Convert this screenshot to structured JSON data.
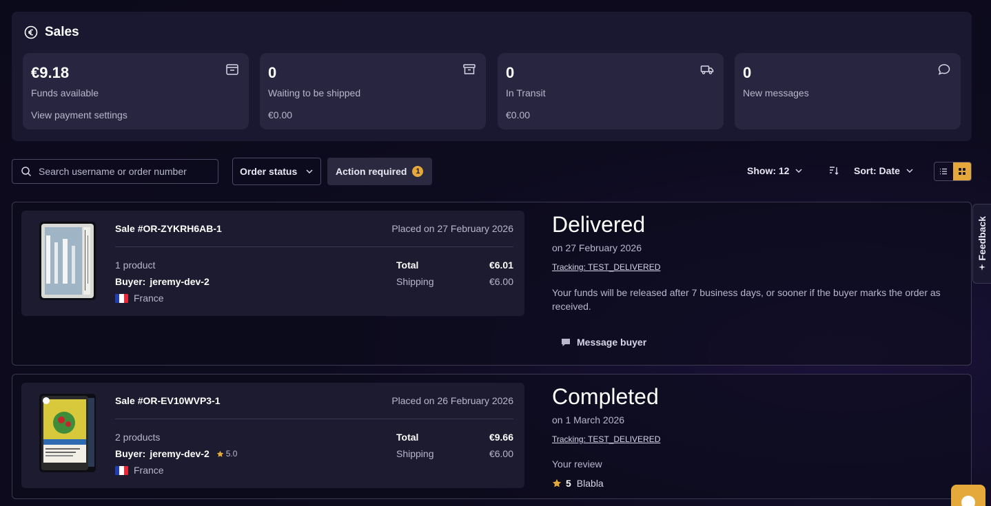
{
  "sales": {
    "title": "Sales",
    "stats": [
      {
        "value": "€9.18",
        "label": "Funds available",
        "sub": "View payment settings",
        "icon": "wallet-icon"
      },
      {
        "value": "0",
        "label": "Waiting to be shipped",
        "sub": "€0.00",
        "icon": "archive-box-icon"
      },
      {
        "value": "0",
        "label": "In Transit",
        "sub": "€0.00",
        "icon": "truck-icon"
      },
      {
        "value": "0",
        "label": "New messages",
        "sub": "",
        "icon": "chat-bubble-icon"
      }
    ]
  },
  "filters": {
    "search_placeholder": "Search username or order number",
    "order_status": "Order status",
    "action_required": "Action required",
    "action_count": "1",
    "show_label": "Show: 12",
    "sort_label": "Sort: Date"
  },
  "orders": [
    {
      "sale_id": "Sale #OR-ZYKRH6AB-1",
      "placed": "Placed on 27 February 2026",
      "products": "1 product",
      "buyer_label": "Buyer:",
      "buyer": "jeremy-dev-2",
      "buyer_rating": "",
      "country": "France",
      "total_label": "Total",
      "total": "€6.01",
      "shipping_label": "Shipping",
      "shipping": "€6.00",
      "status": "Delivered",
      "status_date": "on 27 February 2026",
      "tracking": "Tracking: TEST_DELIVERED",
      "note": "Your funds will be released after 7 business days, or sooner if the buyer marks the order as received.",
      "message_label": "Message buyer"
    },
    {
      "sale_id": "Sale #OR-EV10WVP3-1",
      "placed": "Placed on 26 February 2026",
      "products": "2 products",
      "buyer_label": "Buyer:",
      "buyer": "jeremy-dev-2",
      "buyer_rating": "5.0",
      "country": "France",
      "total_label": "Total",
      "total": "€9.66",
      "shipping_label": "Shipping",
      "shipping": "€6.00",
      "status": "Completed",
      "status_date": "on 1 March 2026",
      "tracking": "Tracking: TEST_DELIVERED",
      "review_label": "Your review",
      "review_score": "5",
      "review_text": "Blabla"
    }
  ],
  "feedback_label": "Feedback",
  "colors": {
    "accent": "#e5a93b",
    "panel": "#1a1831",
    "card": "#27253f"
  }
}
